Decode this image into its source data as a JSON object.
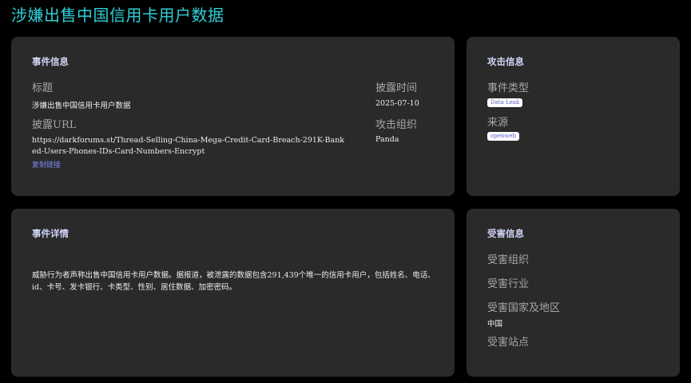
{
  "page_title": "涉嫌出售中国信用卡用户数据",
  "event_info": {
    "heading": "事件信息",
    "title_label": "标题",
    "title_value": "涉嫌出售中国信用卡用户数据",
    "disclosure_time_label": "披露时间",
    "disclosure_time_value": "2025-07-10",
    "url_label": "披露URL",
    "url_value": "https://darkforums.st/Thread-Selling-China-Mega-Credit-Card-Breach-291K-Banked-Users-Phones-IDs-Card-Numbers-Encrypt",
    "copy_link_label": "复制链接",
    "attack_org_label": "攻击组织",
    "attack_org_value": "Panda"
  },
  "attack_info": {
    "heading": "攻击信息",
    "event_type_label": "事件类型",
    "event_type_tag": "Data Leak",
    "source_label": "来源",
    "source_tag": "openweb"
  },
  "event_detail": {
    "heading": "事件详情",
    "text": "威胁行为者声称出售中国信用卡用户数据。据报道，被泄露的数据包含291,439个唯一的信用卡用户，包括姓名、电话、id、卡号、发卡银行、卡类型、性别、居住数据、加密密码。"
  },
  "victim_info": {
    "heading": "受害信息",
    "org_label": "受害组织",
    "industry_label": "受害行业",
    "country_label": "受害国家及地区",
    "country_value": "中国",
    "site_label": "受害站点"
  }
}
